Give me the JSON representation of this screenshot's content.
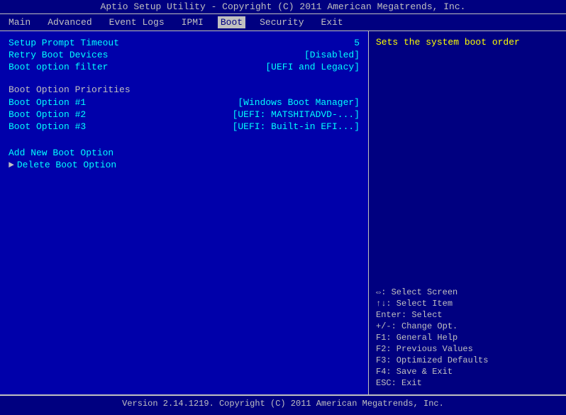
{
  "title": "Aptio Setup Utility - Copyright (C) 2011 American Megatrends, Inc.",
  "nav": {
    "items": [
      {
        "label": "Main",
        "active": false
      },
      {
        "label": "Advanced",
        "active": false
      },
      {
        "label": "Event Logs",
        "active": false
      },
      {
        "label": "IPMI",
        "active": false
      },
      {
        "label": "Boot",
        "active": true
      },
      {
        "label": "Security",
        "active": false
      },
      {
        "label": "Exit",
        "active": false
      }
    ]
  },
  "left": {
    "setup_prompt_timeout_label": "Setup Prompt Timeout",
    "setup_prompt_timeout_value": "5",
    "retry_boot_devices_label": "Retry Boot Devices",
    "retry_boot_devices_value": "[Disabled]",
    "boot_option_filter_label": "Boot option filter",
    "boot_option_filter_value": "[UEFI and Legacy]",
    "boot_option_priorities_header": "Boot Option Priorities",
    "boot_option_1_label": "Boot Option #1",
    "boot_option_1_value": "[Windows Boot Manager]",
    "boot_option_2_label": "Boot Option #2",
    "boot_option_2_value": "[UEFI: MATSHITADVD-...]",
    "boot_option_3_label": "Boot Option #3",
    "boot_option_3_value": "[UEFI: Built-in EFI...]",
    "add_new_boot_option": "Add New Boot Option",
    "delete_boot_option": "Delete Boot Option"
  },
  "right": {
    "help_text": "Sets the system boot order",
    "keys": [
      {
        "key": "⇔: Select Screen"
      },
      {
        "key": "↑↓: Select Item"
      },
      {
        "key": "Enter: Select"
      },
      {
        "key": "+/-: Change Opt."
      },
      {
        "key": "F1: General Help"
      },
      {
        "key": "F2: Previous Values"
      },
      {
        "key": "F3: Optimized Defaults"
      },
      {
        "key": "F4: Save & Exit"
      },
      {
        "key": "ESC: Exit"
      }
    ]
  },
  "footer": "Version 2.14.1219. Copyright (C) 2011 American Megatrends, Inc."
}
